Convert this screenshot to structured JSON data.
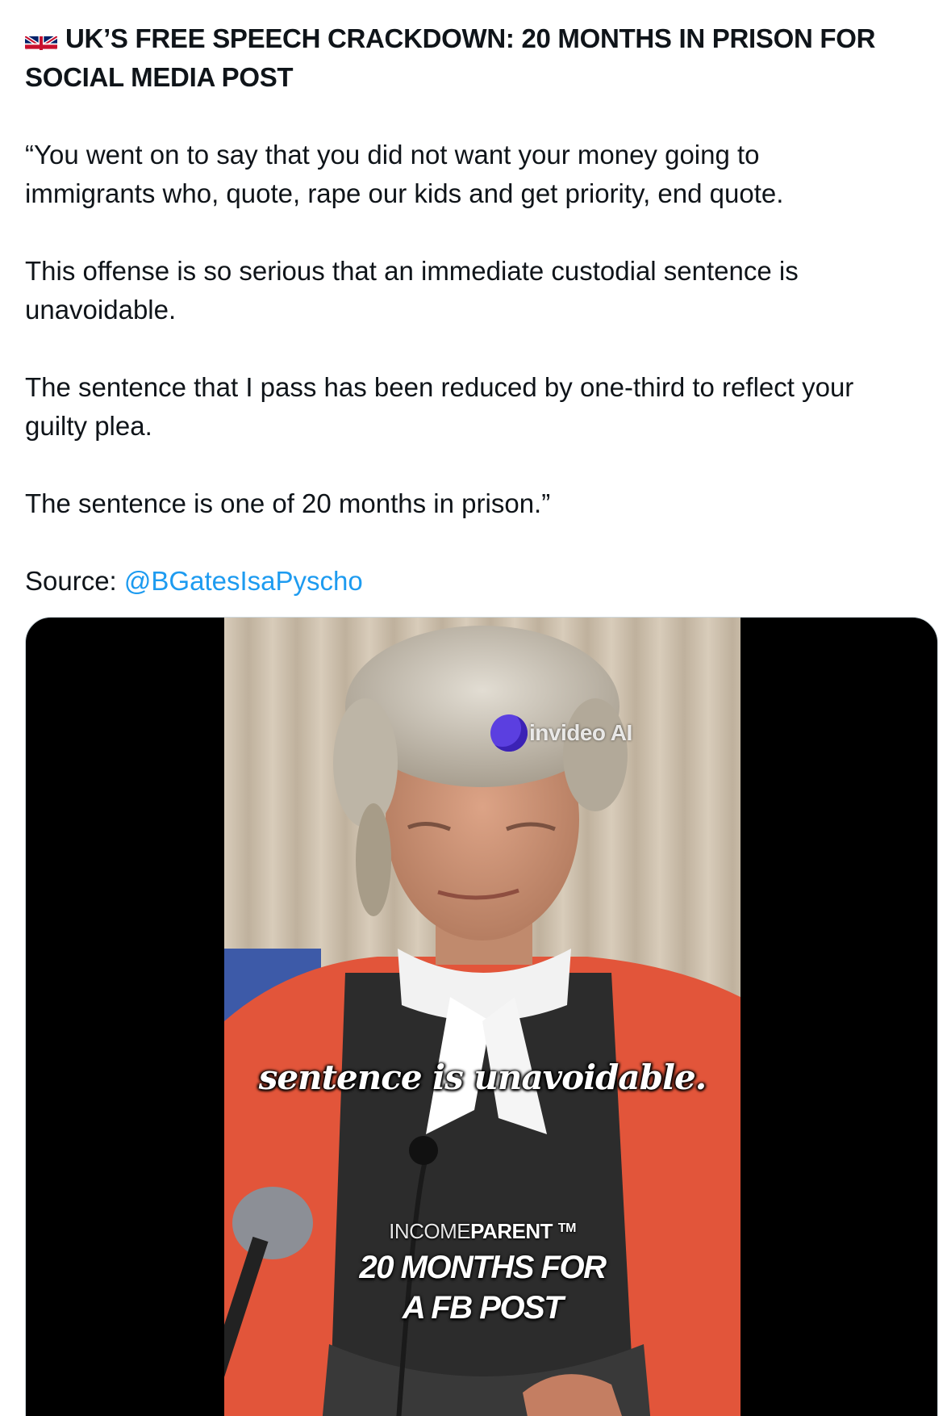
{
  "post": {
    "flag_icon": "uk-flag-icon",
    "headline_line1": "UK’S FREE SPEECH CRACKDOWN: 20 MONTHS IN PRISON FOR",
    "headline_line2": "SOCIAL MEDIA POST",
    "p1_line1": "“You went on to say that you did not want your money going to",
    "p1_line2": "immigrants who, quote, rape our kids and get priority, end quote.",
    "p2_line1": "This offense is so serious that an immediate custodial sentence is",
    "p2_line2": "unavoidable.",
    "p3_line1": "The sentence that I pass has been reduced by one-third to reflect your",
    "p3_line2": "guilty plea.",
    "p4": "The sentence is one of 20 months in prison.”",
    "source_label": "Source:",
    "source_handle": "@BGatesIsaPyscho",
    "mention_color": "#1d9bf0"
  },
  "video": {
    "watermark": "invideo AI",
    "caption": "sentence is unavoidable.",
    "brand_light": "INCOME",
    "brand_bold": "PARENT",
    "brand_tm": "TM",
    "title_line1": "20 MONTHS FOR",
    "title_line2": "A FB POST"
  }
}
